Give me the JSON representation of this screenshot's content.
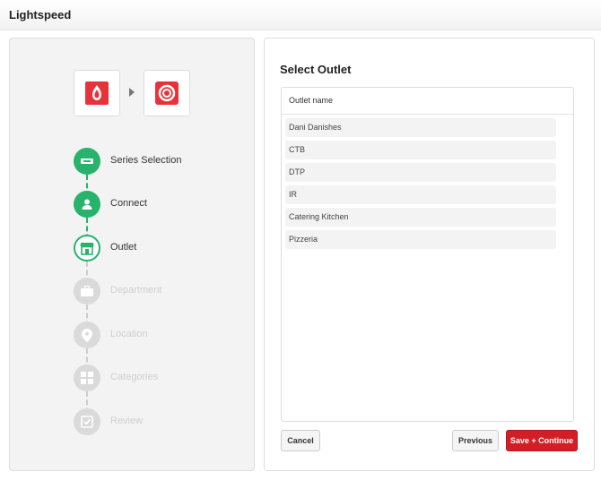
{
  "app": {
    "title": "Lightspeed"
  },
  "steps": [
    {
      "label": "Series Selection",
      "state": "done",
      "icon": "series-icon"
    },
    {
      "label": "Connect",
      "state": "done",
      "icon": "user-icon"
    },
    {
      "label": "Outlet",
      "state": "current",
      "icon": "store-icon"
    },
    {
      "label": "Department",
      "state": "pending",
      "icon": "briefcase-icon"
    },
    {
      "label": "Location",
      "state": "pending",
      "icon": "location-pin-icon"
    },
    {
      "label": "Categories",
      "state": "pending",
      "icon": "grid-icon"
    },
    {
      "label": "Review",
      "state": "pending",
      "icon": "checkbox-edit-icon"
    }
  ],
  "main": {
    "title": "Select Outlet",
    "table_header": "Outlet name",
    "outlets": [
      "Dani Danishes",
      "CTB",
      "DTP",
      "IR",
      "Catering Kitchen",
      "Pizzeria"
    ]
  },
  "buttons": {
    "cancel": "Cancel",
    "previous": "Previous",
    "save": "Save + Continue"
  },
  "colors": {
    "accent_green": "#27b36b",
    "brand_red": "#d21f26",
    "pending_grey": "#dadada"
  }
}
